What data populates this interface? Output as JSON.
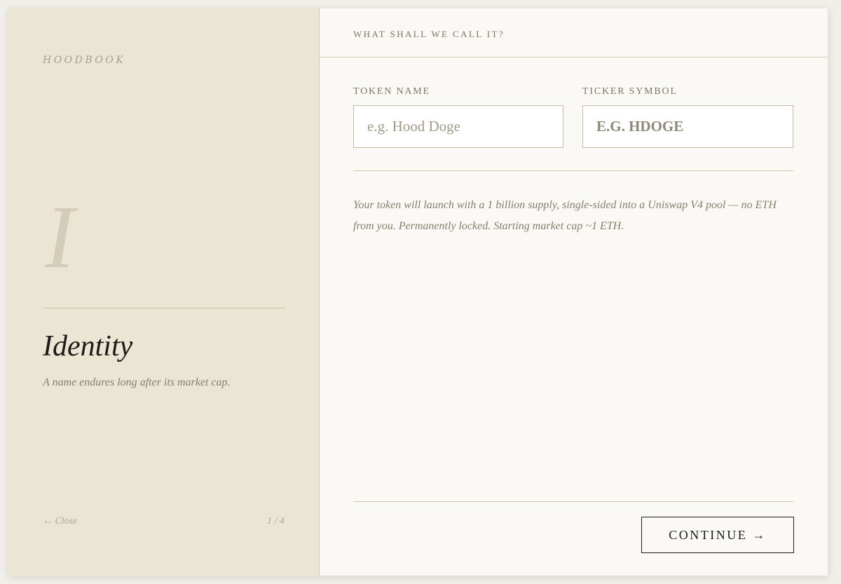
{
  "brand": "HOODBOOK",
  "step": {
    "numeral": "I",
    "title": "Identity",
    "subtitle": "A name endures long after its market cap.",
    "counter": "1 / 4"
  },
  "nav": {
    "close_label": "← Close"
  },
  "form": {
    "header": "WHAT SHALL WE CALL IT?",
    "token_name": {
      "label": "TOKEN NAME",
      "placeholder": "e.g. Hood Doge",
      "value": ""
    },
    "ticker": {
      "label": "TICKER SYMBOL",
      "placeholder": "E.G. HDOGE",
      "value": ""
    },
    "info": "Your token will launch with a 1 billion supply, single-sided into a Uniswap V4 pool — no ETH from you. Permanently locked. Starting market cap ~1 ETH.",
    "continue_label": "CONTINUE →"
  },
  "colors": {
    "left_panel": "#ebe5d4",
    "right_panel": "#fbf9f5",
    "ink": "#1d1b17",
    "muted": "#857e6c"
  }
}
